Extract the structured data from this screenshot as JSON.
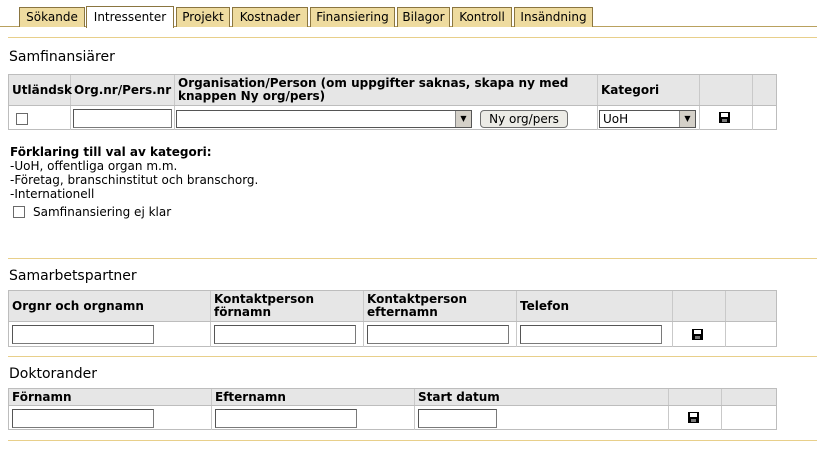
{
  "tabs": [
    {
      "label": "Sökande"
    },
    {
      "label": "Intressenter"
    },
    {
      "label": "Projekt"
    },
    {
      "label": "Kostnader"
    },
    {
      "label": "Finansiering"
    },
    {
      "label": "Bilagor"
    },
    {
      "label": "Kontroll"
    },
    {
      "label": "Insändning"
    }
  ],
  "active_tab": "Intressenter",
  "samfinansiarer": {
    "title": "Samfinansiärer",
    "columns": {
      "utlandsk": "Utländsk",
      "orgnr": "Org.nr/Pers.nr",
      "organisation": "Organisation/Person (om uppgifter saknas, skapa ny med knappen Ny org/pers)",
      "kategori": "Kategori"
    },
    "row": {
      "orgnr_value": "",
      "organisation_value": "",
      "kategori_value": "UoH"
    },
    "new_button": "Ny org/pers",
    "explain_title": "Förklaring till val av kategori:",
    "explain_lines": [
      "-UoH, offentliga organ m.m.",
      "-Företag, branschinstitut och branschorg.",
      "-Internationell"
    ],
    "not_ready_label": "Samfinansiering ej klar"
  },
  "samarbetspartner": {
    "title": "Samarbetspartner",
    "columns": {
      "orgnr": "Orgnr och orgnamn",
      "fornamn": "Kontaktperson förnamn",
      "efternamn": "Kontaktperson efternamn",
      "telefon": "Telefon"
    }
  },
  "doktorander": {
    "title": "Doktorander",
    "columns": {
      "fornamn": "Förnamn",
      "efternamn": "Efternamn",
      "start": "Start datum"
    }
  },
  "icons": {
    "save": "floppy-disk-icon",
    "dropdown": "triangle-down"
  },
  "colors": {
    "tab_bg": "#eedb9f",
    "rule": "#e8cf8a",
    "header_bg": "#e6e6e6"
  }
}
